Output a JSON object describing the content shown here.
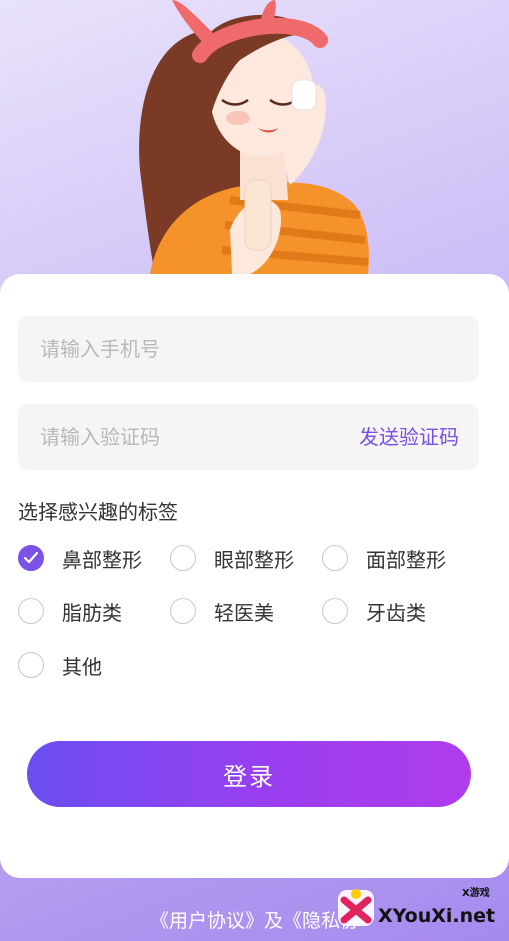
{
  "login_form": {
    "phone_placeholder": "请输入手机号",
    "code_placeholder": "请输入验证码",
    "send_code_label": "发送验证码"
  },
  "tags": {
    "title": "选择感兴趣的标签",
    "items": [
      {
        "label": "鼻部整形",
        "checked": true
      },
      {
        "label": "眼部整形",
        "checked": false
      },
      {
        "label": "面部整形",
        "checked": false
      },
      {
        "label": "脂肪类",
        "checked": false
      },
      {
        "label": "轻医美",
        "checked": false
      },
      {
        "label": "牙齿类",
        "checked": false
      },
      {
        "label": "其他",
        "checked": false
      }
    ]
  },
  "login_button_label": "登录",
  "footer_text": "《用户协议》及《隐私协",
  "watermark": {
    "brand": "XYouXi.net",
    "tag": "X游戏"
  },
  "colors": {
    "accent": "#7a52e6",
    "button_start": "#6a4ef0",
    "button_end": "#b03ceb"
  }
}
